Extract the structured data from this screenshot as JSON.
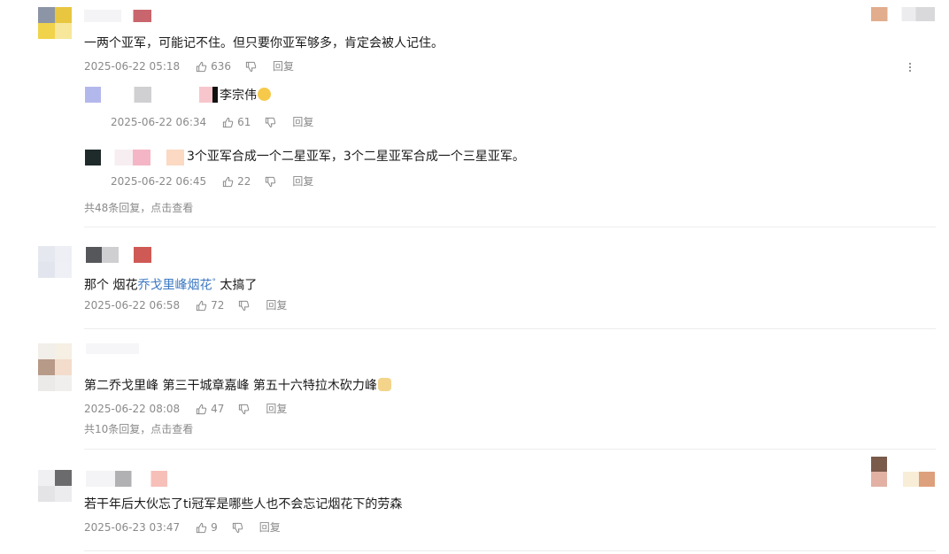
{
  "comments": [
    {
      "text": "一两个亚军，可能记不住。但只要你亚军够多，肯定会被人记住。",
      "time": "2025-06-22 05:18",
      "likes": "636",
      "reply_label": "回复",
      "replies": [
        {
          "text": "李宗伟",
          "time": "2025-06-22 06:34",
          "likes": "61",
          "reply_label": "回复"
        },
        {
          "text": "3个亚军合成一个二星亚军，3个二星亚军合成一个三星亚军。",
          "time": "2025-06-22 06:45",
          "likes": "22",
          "reply_label": "回复"
        }
      ],
      "more_replies": "共48条回复，点击查看"
    },
    {
      "text_prefix": "那个 烟花",
      "link_text": "乔戈里峰烟花",
      "text_suffix": " 太搞了",
      "time": "2025-06-22 06:58",
      "likes": "72",
      "reply_label": "回复"
    },
    {
      "text": "第二乔戈里峰 第三干城章嘉峰 第五十六特拉木砍力峰",
      "time": "2025-06-22 08:08",
      "likes": "47",
      "reply_label": "回复",
      "more_replies": "共10条回复，点击查看"
    },
    {
      "text": "若干年后大伙忘了ti冠军是哪些人也不会忘记烟花下的劳森",
      "time": "2025-06-23 03:47",
      "likes": "9",
      "reply_label": "回复"
    }
  ],
  "icons": {
    "like": "thumbs-up-icon",
    "dislike": "thumbs-down-icon",
    "more": "more-vertical-icon",
    "emoji_laugh": "laughing-emoji-icon",
    "emoji_cat": "cat-emoji-icon"
  },
  "colors": {
    "link": "#3b78c3",
    "meta": "#8a8a8a",
    "divider": "#ececec"
  }
}
